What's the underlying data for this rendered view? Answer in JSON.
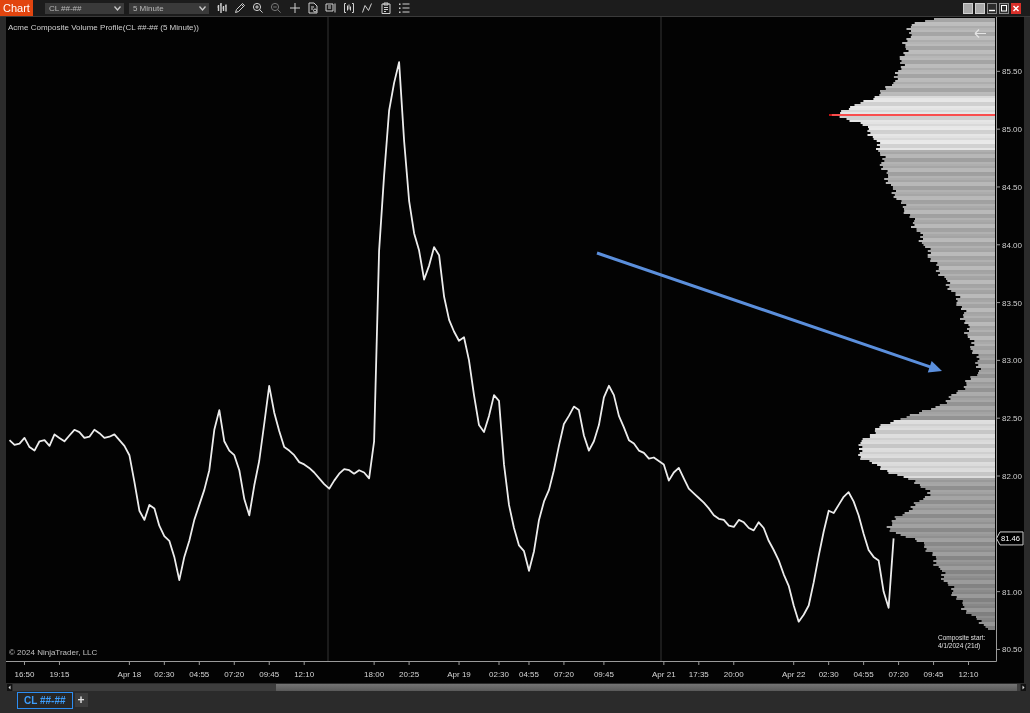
{
  "window": {
    "title": "Chart"
  },
  "toolbar": {
    "instrument": {
      "value": "CL ##-##"
    },
    "interval": {
      "value": "5 Minute"
    }
  },
  "chart": {
    "indicator_label": "Acme Composite Volume Profile(CL ##-## (5 Minute))",
    "copyright": "© 2024 NinjaTrader, LLC",
    "composite_note": [
      "Composite start:",
      "4/1/2024 (21d)"
    ],
    "last_price": "81.46",
    "chart_data": {
      "type": "line",
      "ylim": [
        80.4,
        85.97
      ],
      "yticks": [
        {
          "value": 85.5,
          "label": "85.50"
        },
        {
          "value": 85.0,
          "label": "85.00"
        },
        {
          "value": 84.5,
          "label": "84.50"
        },
        {
          "value": 84.0,
          "label": "84.00"
        },
        {
          "value": 83.5,
          "label": "83.50"
        },
        {
          "value": 83.0,
          "label": "83.00"
        },
        {
          "value": 82.5,
          "label": "82.50"
        },
        {
          "value": 82.0,
          "label": "82.00"
        },
        {
          "value": 81.0,
          "label": "81.00"
        },
        {
          "value": 80.5,
          "label": "80.50"
        }
      ],
      "categories": [
        null,
        null,
        null,
        "16:50",
        null,
        null,
        null,
        null,
        null,
        null,
        "19:15",
        null,
        null,
        null,
        null,
        null,
        null,
        null,
        null,
        null,
        null,
        null,
        null,
        null,
        "Apr 18",
        null,
        null,
        null,
        null,
        null,
        null,
        "02:30",
        null,
        null,
        null,
        null,
        null,
        null,
        "04:55",
        null,
        null,
        null,
        null,
        null,
        null,
        "07:20",
        null,
        null,
        null,
        null,
        null,
        null,
        "09:45",
        null,
        null,
        null,
        null,
        null,
        null,
        "12:10",
        null,
        null,
        null,
        null,
        null,
        null,
        null,
        null,
        null,
        null,
        null,
        null,
        null,
        "18:00",
        null,
        null,
        null,
        null,
        null,
        null,
        "20:25",
        null,
        null,
        null,
        null,
        null,
        null,
        null,
        null,
        null,
        "Apr 19",
        null,
        null,
        null,
        null,
        null,
        null,
        null,
        "02:30",
        null,
        null,
        null,
        null,
        null,
        "04:55",
        null,
        null,
        null,
        null,
        null,
        null,
        "07:20",
        null,
        null,
        null,
        null,
        null,
        null,
        null,
        "09:45",
        null,
        null,
        null,
        null,
        null,
        null,
        null,
        null,
        null,
        null,
        null,
        "Apr 21",
        null,
        null,
        null,
        null,
        null,
        null,
        "17:35",
        null,
        null,
        null,
        null,
        null,
        null,
        "20:00",
        null,
        null,
        null,
        null,
        null,
        null,
        null,
        null,
        null,
        null,
        null,
        "Apr 22",
        null,
        null,
        null,
        null,
        null,
        null,
        "02:30",
        null,
        null,
        null,
        null,
        null,
        null,
        "04:55",
        null,
        null,
        null,
        null,
        null,
        null,
        "07:20",
        null,
        null,
        null,
        null,
        null,
        null,
        "09:45",
        null,
        null,
        null,
        null,
        null,
        null,
        "12:10",
        null,
        null,
        null,
        null,
        null
      ],
      "values": [
        82.31,
        82.27,
        82.28,
        82.33,
        82.25,
        82.22,
        82.3,
        82.31,
        82.26,
        82.36,
        82.33,
        82.3,
        82.35,
        82.4,
        82.38,
        82.33,
        82.34,
        82.4,
        82.37,
        82.33,
        82.34,
        82.36,
        82.31,
        82.26,
        82.18,
        81.95,
        81.7,
        81.62,
        81.75,
        81.72,
        81.57,
        81.48,
        81.44,
        81.3,
        81.1,
        81.3,
        81.44,
        81.62,
        81.75,
        81.88,
        82.05,
        82.4,
        82.57,
        82.3,
        82.22,
        82.18,
        82.05,
        81.8,
        81.66,
        81.92,
        82.13,
        82.45,
        82.78,
        82.55,
        82.39,
        82.25,
        82.22,
        82.18,
        82.12,
        82.1,
        82.07,
        82.03,
        81.98,
        81.93,
        81.89,
        81.96,
        82.02,
        82.06,
        82.05,
        82.02,
        82.05,
        82.03,
        81.98,
        82.3,
        83.95,
        84.6,
        85.16,
        85.4,
        85.58,
        84.9,
        84.38,
        84.1,
        83.95,
        83.7,
        83.82,
        83.98,
        83.91,
        83.55,
        83.35,
        83.25,
        83.17,
        83.2,
        83.0,
        82.7,
        82.44,
        82.38,
        82.52,
        82.7,
        82.65,
        82.1,
        81.75,
        81.55,
        81.4,
        81.35,
        81.18,
        81.35,
        81.62,
        81.78,
        81.88,
        82.05,
        82.26,
        82.45,
        82.52,
        82.6,
        82.57,
        82.35,
        82.22,
        82.3,
        82.44,
        82.68,
        82.78,
        82.7,
        82.52,
        82.42,
        82.31,
        82.28,
        82.22,
        82.2,
        82.15,
        82.16,
        82.13,
        82.1,
        81.96,
        82.03,
        82.07,
        81.98,
        81.89,
        81.85,
        81.81,
        81.77,
        81.72,
        81.66,
        81.63,
        81.62,
        81.57,
        81.56,
        81.62,
        81.6,
        81.55,
        81.53,
        81.6,
        81.55,
        81.44,
        81.36,
        81.27,
        81.15,
        81.05,
        80.88,
        80.74,
        80.8,
        80.88,
        81.08,
        81.31,
        81.52,
        81.7,
        81.68,
        81.75,
        81.82,
        81.86,
        81.78,
        81.66,
        81.5,
        81.36,
        81.3,
        81.27,
        81.0,
        80.86,
        81.46,
        null,
        null,
        null,
        null,
        null,
        null,
        null,
        null,
        null,
        null,
        null,
        null,
        null,
        null,
        null,
        null,
        null,
        null,
        null,
        null
      ]
    }
  },
  "tabs": [
    {
      "label": "CL ##-##",
      "selected": true
    }
  ],
  "add_tab": {
    "label": "+"
  }
}
